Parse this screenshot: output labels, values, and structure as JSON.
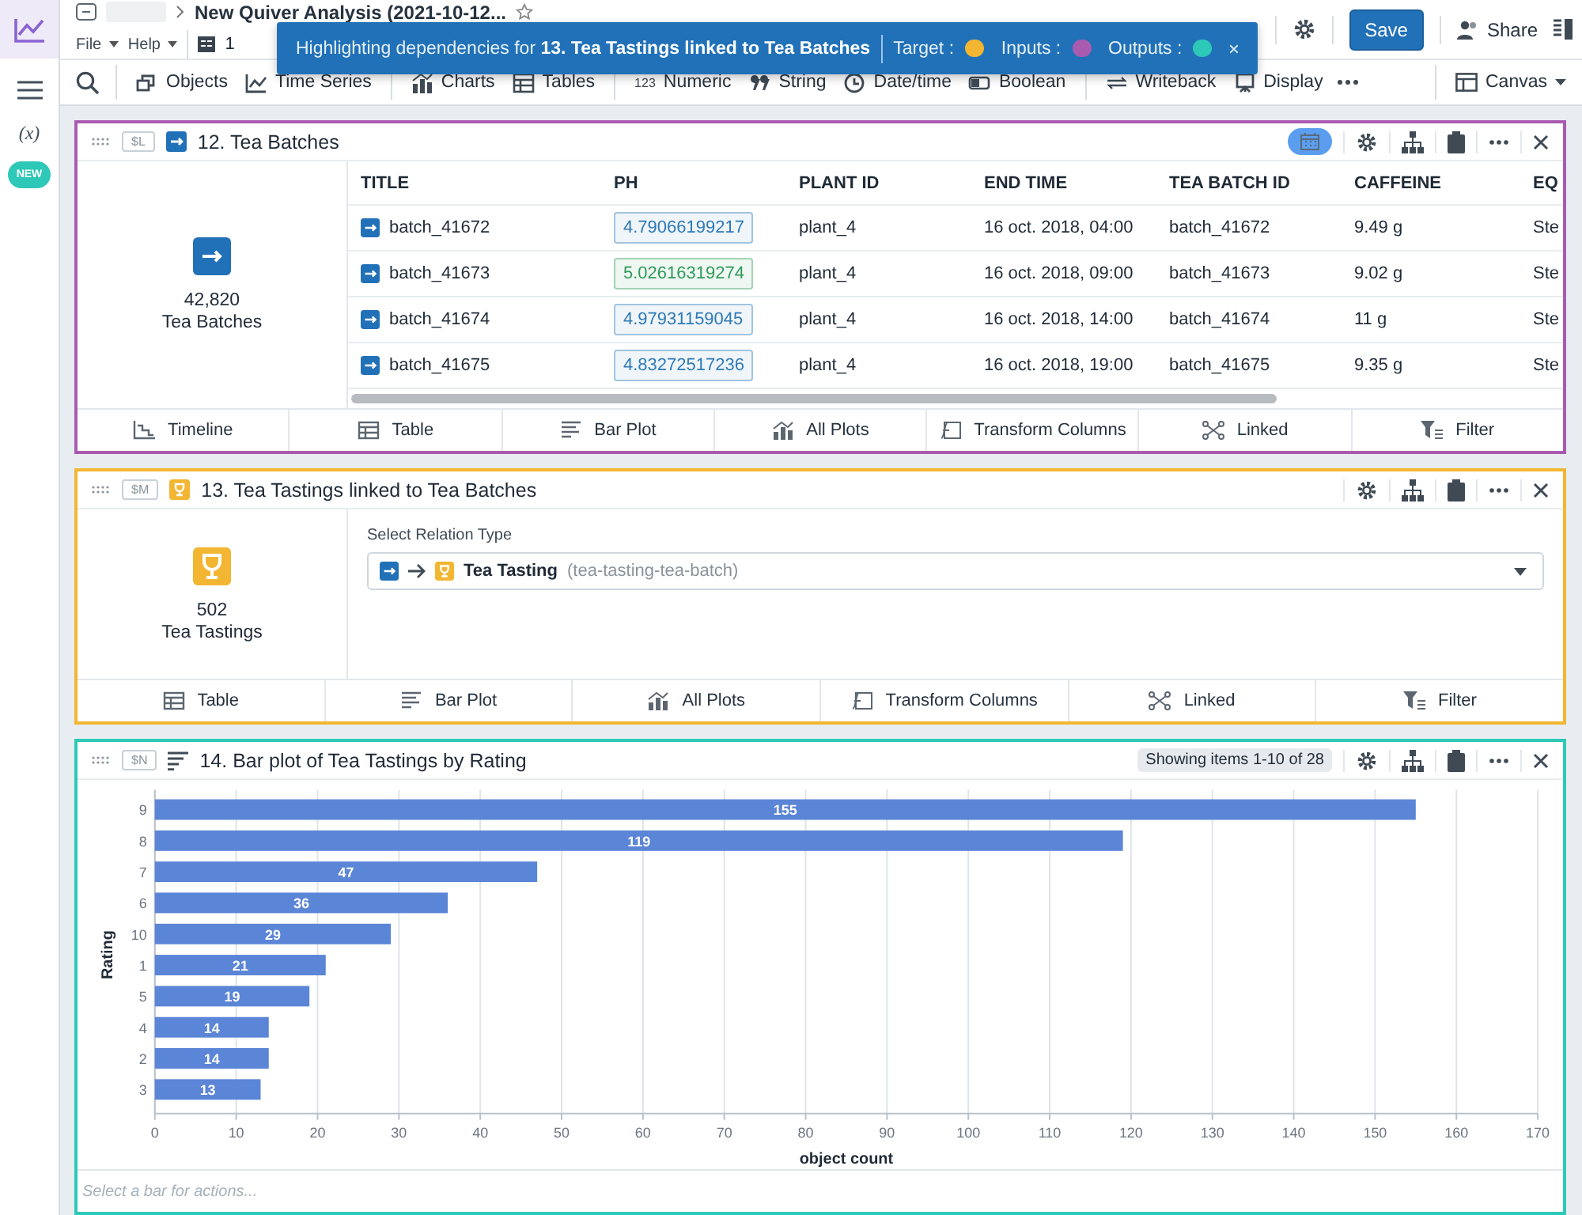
{
  "rail": {
    "variable_label": "(x)",
    "badge": "NEW"
  },
  "header": {
    "title": "New Quiver Analysis (2021-10-12...",
    "menus": [
      "File",
      "Help"
    ],
    "page_count": "1",
    "save": "Save",
    "share": "Share"
  },
  "banner": {
    "text": "Highlighting dependencies for **13. Tea Tastings linked to Tea Batches**",
    "legend": [
      {
        "label": "Target :",
        "color": "#f2b632"
      },
      {
        "label": "Inputs :",
        "color": "#a95bb0"
      },
      {
        "label": "Outputs :",
        "color": "#2ec8b8"
      }
    ]
  },
  "toolbar": [
    {
      "kind": "objects",
      "label": "Objects",
      "divider_after": false
    },
    {
      "kind": "timeseries",
      "label": "Time Series",
      "divider_after": true
    },
    {
      "kind": "charts",
      "label": "Charts",
      "divider_after": false
    },
    {
      "kind": "tables",
      "label": "Tables",
      "divider_after": true
    },
    {
      "kind": "numeric",
      "glyph": "123",
      "label": "Numeric",
      "divider_after": false
    },
    {
      "kind": "string",
      "label": "String",
      "divider_after": false
    },
    {
      "kind": "datetime",
      "label": "Date/time",
      "divider_after": false
    },
    {
      "kind": "boolean",
      "label": "Boolean",
      "divider_after": true
    },
    {
      "kind": "writeback",
      "label": "Writeback",
      "divider_after": false
    },
    {
      "kind": "display",
      "label": "Display",
      "divider_after": false
    }
  ],
  "canvas_button": "Canvas",
  "panels": [
    {
      "kind": "table",
      "tag": "$L",
      "title": "12. Tea Batches",
      "color": "#a95bb0",
      "count": "42,820",
      "object_name": "Tea Batches",
      "timeline_on": true,
      "columns": [
        "TITLE",
        "PH",
        "PLANT ID",
        "END TIME",
        "TEA BATCH ID",
        "CAFFEINE",
        "EQ"
      ],
      "rows": [
        {
          "color": "#2e7ab8",
          "cells": [
            "batch_41672",
            "4.79066199217",
            "plant_4",
            "16 oct. 2018, 04:00",
            "batch_41672",
            "9.49 g",
            "Ste"
          ]
        },
        {
          "color": "#2f9a5a",
          "cells": [
            "batch_41673",
            "5.02616319274",
            "plant_4",
            "16 oct. 2018, 09:00",
            "batch_41673",
            "9.02 g",
            "Ste"
          ]
        },
        {
          "color": "#2e7ab8",
          "cells": [
            "batch_41674",
            "4.97931159045",
            "plant_4",
            "16 oct. 2018, 14:00",
            "batch_41674",
            "11 g",
            "Ste"
          ]
        },
        {
          "color": "#2e7ab8",
          "cells": [
            "batch_41675",
            "4.83272517236",
            "plant_4",
            "16 oct. 2018, 19:00",
            "batch_41675",
            "9.35 g",
            "Ste"
          ]
        }
      ],
      "tabs": [
        {
          "kind": "timeline",
          "label": "Timeline"
        },
        {
          "kind": "table",
          "label": "Table"
        },
        {
          "kind": "bar",
          "label": "Bar Plot"
        },
        {
          "kind": "plots",
          "label": "All Plots"
        },
        {
          "kind": "transform",
          "label": "Transform Columns"
        },
        {
          "kind": "linked",
          "label": "Linked"
        },
        {
          "kind": "filter",
          "label": "Filter"
        }
      ]
    },
    {
      "kind": "relation",
      "tag": "$M",
      "title": "13. Tea Tastings linked to Tea Batches",
      "color": "#f2b632",
      "count": "502",
      "object_name": "Tea Tastings",
      "select_label": "Select Relation Type",
      "relation": "Tea Tasting",
      "relation_id": "(tea-tasting-tea-batch)",
      "tabs": [
        {
          "kind": "table",
          "label": "Table"
        },
        {
          "kind": "bar",
          "label": "Bar Plot"
        },
        {
          "kind": "plots",
          "label": "All Plots"
        },
        {
          "kind": "transform",
          "label": "Transform Columns"
        },
        {
          "kind": "linked",
          "label": "Linked"
        },
        {
          "kind": "filter",
          "label": "Filter"
        }
      ]
    },
    {
      "kind": "chart",
      "tag": "$N",
      "title": "14. Bar plot of Tea Tastings by Rating",
      "color": "#2ec8b8",
      "status": "Showing items 1-10 of 28",
      "footer_placeholder": "Select a bar for actions...",
      "chart_data": {
        "type": "bar",
        "orientation": "horizontal",
        "xlabel": "object count",
        "ylabel": "Rating",
        "categories": [
          "9",
          "8",
          "7",
          "6",
          "10",
          "1",
          "5",
          "4",
          "2",
          "3"
        ],
        "values": [
          155,
          119,
          47,
          36,
          29,
          21,
          19,
          14,
          14,
          13
        ],
        "grid": true,
        "xlim": [
          0,
          170
        ],
        "xticks": [
          0,
          10,
          20,
          30,
          40,
          50,
          60,
          70,
          80,
          90,
          100,
          110,
          120,
          130,
          140,
          150,
          160,
          170
        ],
        "data_labels": true
      }
    }
  ]
}
